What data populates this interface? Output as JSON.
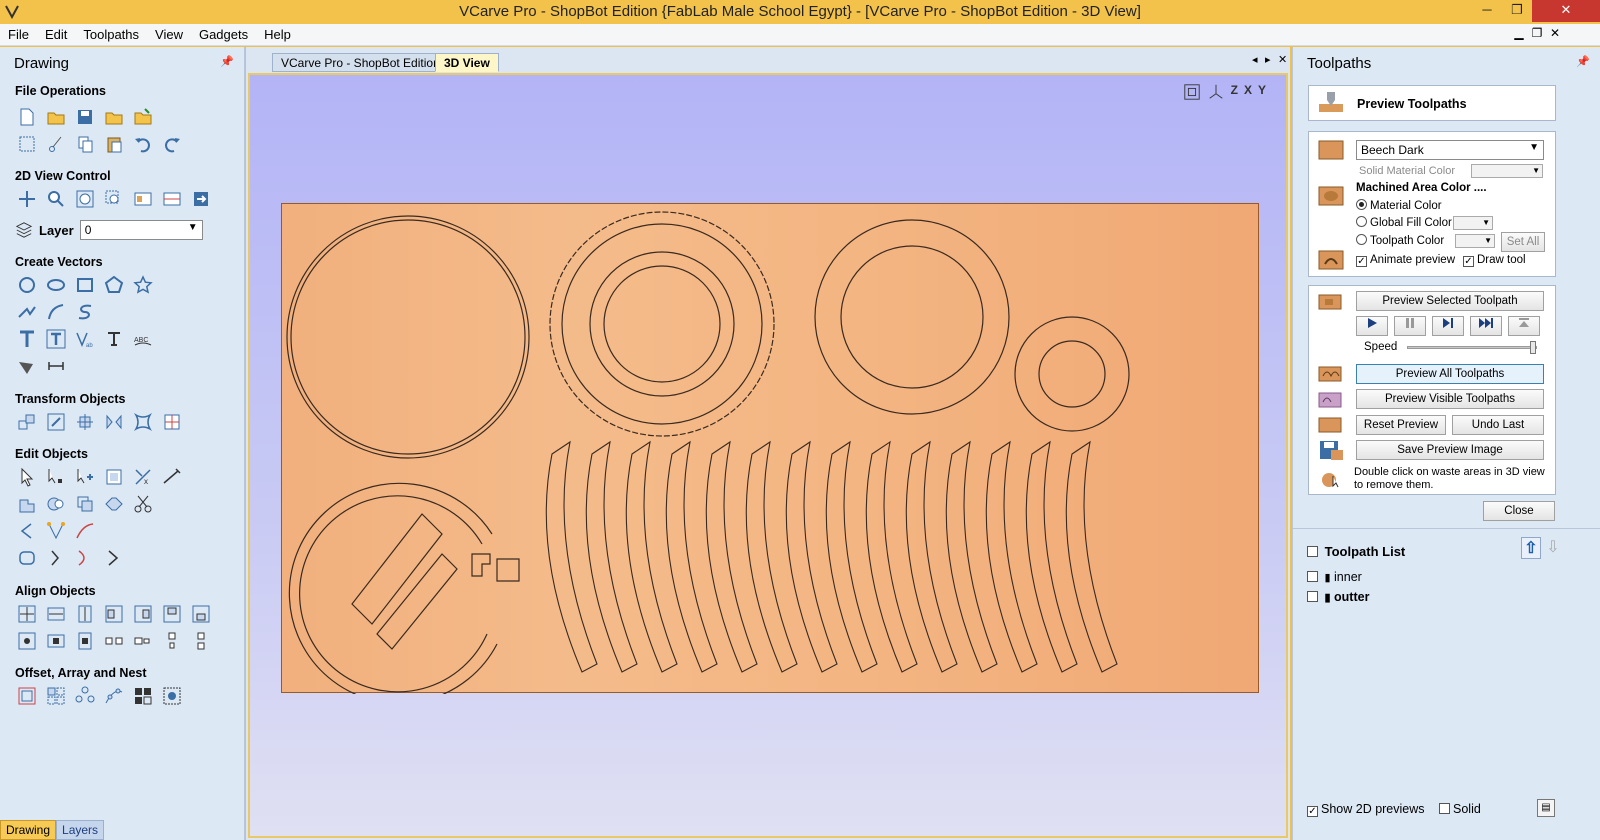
{
  "window": {
    "title": "VCarve Pro - ShopBot Edition {FabLab Male School Egypt} - [VCarve Pro - ShopBot Edition - 3D View]"
  },
  "menu": [
    "File",
    "Edit",
    "Toolpaths",
    "View",
    "Gadgets",
    "Help"
  ],
  "left_panel": {
    "title": "Drawing",
    "sections": {
      "file_ops": "File Operations",
      "view_2d": "2D View Control",
      "create_vectors": "Create Vectors",
      "transform": "Transform Objects",
      "edit": "Edit Objects",
      "align": "Align Objects",
      "offset": "Offset, Array and Nest"
    },
    "layer": {
      "label": "Layer",
      "value": "0"
    },
    "bottom_tabs": [
      "Drawing",
      "Layers"
    ]
  },
  "document_tabs": [
    {
      "label": "VCarve Pro - ShopBot Edition",
      "active": false
    },
    {
      "label": "3D View",
      "active": true
    }
  ],
  "view_toolbar": [
    "fit-view",
    "iso-view",
    "Z",
    "X",
    "Y"
  ],
  "right_panel": {
    "title": "Toolpaths",
    "preview_header": "Preview Toolpaths",
    "material": "Beech Dark",
    "solid_material_color": "Solid Material Color",
    "machined_area_color": "Machined Area Color ....",
    "radio": {
      "material_color": "Material Color",
      "global_fill_color": "Global Fill Color",
      "toolpath_color": "Toolpath Color"
    },
    "set_all": "Set All",
    "animate_preview": "Animate preview",
    "draw_tool": "Draw tool",
    "preview_selected": "Preview Selected Toolpath",
    "speed": "Speed",
    "speed_level": 0.98,
    "preview_all": "Preview All Toolpaths",
    "preview_visible": "Preview Visible Toolpaths",
    "reset_preview": "Reset Preview",
    "undo_last": "Undo Last",
    "save_preview_image": "Save Preview Image",
    "hint": "Double click on waste areas in 3D view to remove them.",
    "close": "Close",
    "toolpath_list_title": "Toolpath List",
    "toolpaths": [
      "inner",
      "outter"
    ],
    "show_2d_previews": "Show 2D previews",
    "solid": "Solid"
  },
  "colors": {
    "accent": "#f2c24b",
    "panel": "#dde8f5",
    "wood": "#f2b27f"
  }
}
